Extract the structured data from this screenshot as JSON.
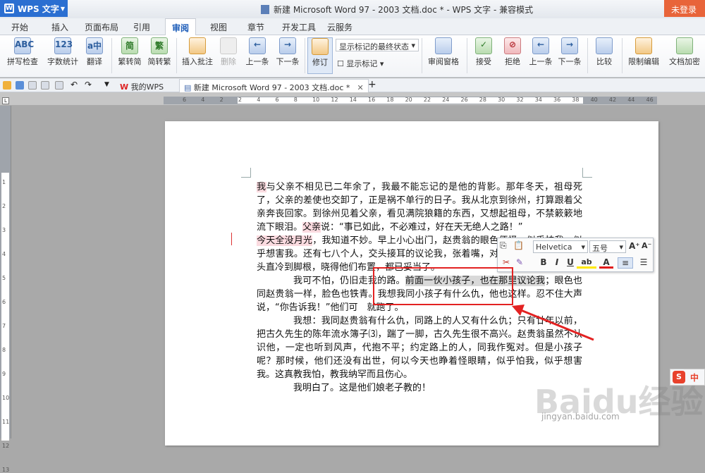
{
  "app": {
    "menu_label": "WPS 文字",
    "title": "新建 Microsoft Word 97 - 2003 文档.doc * - WPS 文字 - 兼容模式",
    "login": "未登录"
  },
  "tabs": [
    "开始",
    "插入",
    "页面布局",
    "引用",
    "审阅",
    "视图",
    "章节",
    "开发工具",
    "云服务"
  ],
  "active_tab": "审阅",
  "ribbon": {
    "spell": "拼写检查",
    "wordcount": "字数统计",
    "translate": "翻译",
    "trad2simp": "繁转简",
    "simp2trad": "简转繁",
    "insert_comment": "插入批注",
    "delete": "删除",
    "prev": "上一条",
    "next": "下一条",
    "track": "修订",
    "display_select": "显示标记的最终状态",
    "show_markup": "显示标记",
    "review_pane": "审阅窗格",
    "accept": "接受",
    "reject": "拒绝",
    "prev2": "上一条",
    "next2": "下一条",
    "compare": "比较",
    "restrict": "限制编辑",
    "doc_encrypt": "文档加密"
  },
  "doc_tabs": {
    "mywps": "我的WPS",
    "current": "新建 Microsoft Word 97 - 2003 文档.doc *",
    "add": "+"
  },
  "ruler_numbers": [
    "6",
    "4",
    "2",
    "2",
    "4",
    "6",
    "8",
    "10",
    "12",
    "14",
    "16",
    "18",
    "20",
    "22",
    "24",
    "26",
    "28",
    "30",
    "32",
    "34",
    "36",
    "38",
    "40",
    "42",
    "44",
    "46"
  ],
  "vruler_numbers": [
    "1",
    "2",
    "3",
    "4",
    "5",
    "6",
    "7",
    "8",
    "9",
    "10",
    "11",
    "12",
    "13"
  ],
  "document": {
    "p1a": "我",
    "p1b": "与父亲不相见已二年余了，我最不能忘记的是他的背影。那年冬天，祖母死了，父亲的差使也交卸了，正是祸不单行的日子。我从北京到徐州，打算跟着父亲奔丧回家。到徐州见着父亲，看见满院狼籍的东西，又想起祖母，不禁簌簌地流下眼泪。",
    "p1c": "父亲",
    "p1d": "说：“事已如此，不必难过，好在天无绝人之路！”",
    "p2a": "今天全没月光",
    "p2b": "，我知道不妙。早上小心出门，赵贵翁的眼色便怪，似乎怕我，似乎想害我。还有七八个人，交头接耳的议论我，张着嘴，对我笑了一笑；我便从头直冷到脚根，晓得他们布置，都已妥当了。",
    "p3a": "我可不怕，仍旧走我的路。",
    "p3sel": "前面一伙小孩子，也在那里议论我",
    "p3b": "；眼色也同赵贵翁一样，脸色也铁青。我想我同小孩子有什么仇，他也这样。忍不住大声说，“你告诉我！”他们可　就跑了。",
    "p4": "我想：我同赵贵翁有什么仇，同路上的人又有什么仇；只有廿年以前，把古久先生的陈年流水簿子⑶，踹了一脚，古久先生很不高兴。赵贵翁虽然不认识他，一定也听到风声，代抱不平；约定路上的人，同我作冤对。但是小孩子呢？那时候，他们还没有出世，何以今天也睁着怪眼睛，似乎怕我，似乎想害我。这真教我怕，教我纳罕而且伤心。",
    "p5": "我明白了。这是他们娘老子教的！"
  },
  "mini_toolbar": {
    "font": "Helvetica",
    "size": "五号",
    "bold": "B",
    "italic": "I",
    "underline": "U",
    "grow": "A⁺",
    "shrink": "A⁻",
    "highlight": "ab",
    "font_color": "A"
  },
  "watermark": {
    "brand": "Baidu经验",
    "url": "jingyan.baidu.com"
  },
  "ime": {
    "logo": "S",
    "mode": "中"
  }
}
